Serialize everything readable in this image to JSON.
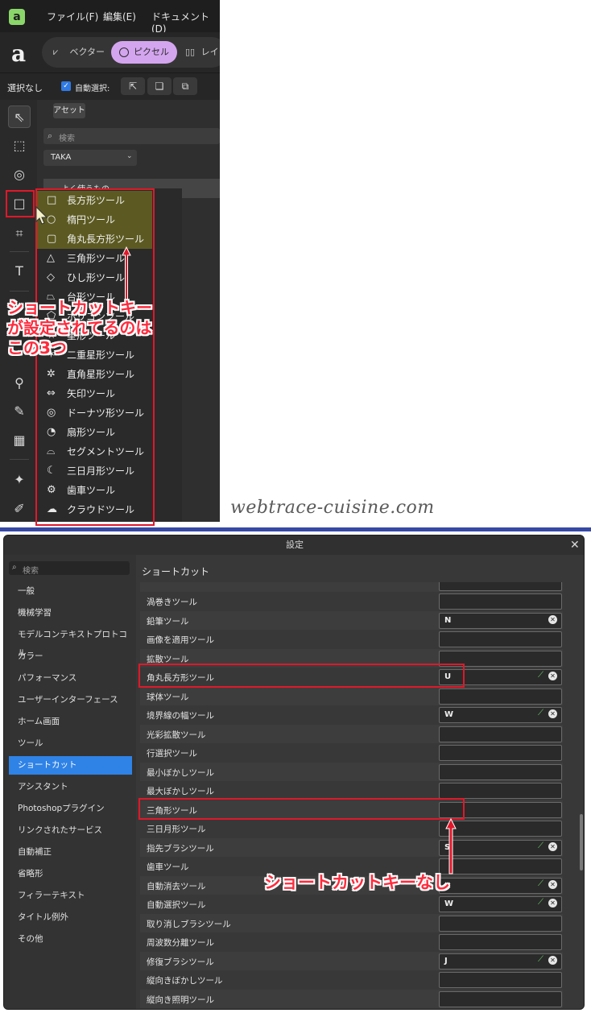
{
  "app": {
    "menus": [
      "ファイル(F)",
      "編集(E)",
      "ドキュメント(D)"
    ],
    "personas": [
      "ベクター",
      "ピクセル",
      "レイ"
    ],
    "context": {
      "selection_label": "選択なし",
      "auto_select_label": "自動選択:"
    },
    "panel": {
      "tab_label": "アセット",
      "search_placeholder": "検索",
      "library_value": "TAKA",
      "category_label": "よく使うもの"
    }
  },
  "flyout": {
    "items": [
      "長方形ツール",
      "楕円ツール",
      "角丸長方形ツール",
      "三角形ツール",
      "ひし形ツール",
      "台形ツール",
      "ポリゴンツール",
      "星形ツール",
      "二重星形ツール",
      "直角星形ツール",
      "矢印ツール",
      "ドーナツ形ツール",
      "扇形ツール",
      "セグメントツール",
      "三日月形ツール",
      "歯車ツール",
      "クラウドツール"
    ]
  },
  "annotations": {
    "callout_top": [
      "ショートカットキー",
      "が設定されてるのは",
      "この3つ"
    ],
    "callout_bottom": "ショートカットキーなし",
    "watermark": "webtrace-cuisine.com"
  },
  "dialog": {
    "title": "設定",
    "search_placeholder": "検索",
    "section_title": "ショートカット",
    "sidebar": [
      "一般",
      "機械学習",
      "モデルコンテキストプロトコル",
      "カラー",
      "パフォーマンス",
      "ユーザーインターフェース",
      "ホーム画面",
      "ツール",
      "ショートカット",
      "アシスタント",
      "Photoshopプラグイン",
      "リンクされたサービス",
      "自動補正",
      "省略形",
      "フィラーテキスト",
      "タイトル例外",
      "その他"
    ],
    "active_sidebar_index": 8,
    "rows": [
      {
        "label": "渦巻きツール",
        "key": "",
        "custom": false,
        "clear": false
      },
      {
        "label": "鉛筆ツール",
        "key": "N",
        "custom": false,
        "clear": true
      },
      {
        "label": "画像を適用ツール",
        "key": "",
        "custom": false,
        "clear": false
      },
      {
        "label": "拡散ツール",
        "key": "",
        "custom": false,
        "clear": false
      },
      {
        "label": "角丸長方形ツール",
        "key": "U",
        "custom": true,
        "clear": true
      },
      {
        "label": "球体ツール",
        "key": "",
        "custom": false,
        "clear": false
      },
      {
        "label": "境界線の幅ツール",
        "key": "W",
        "custom": true,
        "clear": true
      },
      {
        "label": "光彩拡散ツール",
        "key": "",
        "custom": false,
        "clear": false
      },
      {
        "label": "行選択ツール",
        "key": "",
        "custom": false,
        "clear": false
      },
      {
        "label": "最小ぼかしツール",
        "key": "",
        "custom": false,
        "clear": false
      },
      {
        "label": "最大ぼかしツール",
        "key": "",
        "custom": false,
        "clear": false
      },
      {
        "label": "三角形ツール",
        "key": "",
        "custom": false,
        "clear": false
      },
      {
        "label": "三日月形ツール",
        "key": "",
        "custom": false,
        "clear": false
      },
      {
        "label": "指先ブラシツール",
        "key": "S",
        "custom": true,
        "clear": true
      },
      {
        "label": "歯車ツール",
        "key": "",
        "custom": false,
        "clear": false
      },
      {
        "label": "自動消去ツール",
        "key": "",
        "custom": true,
        "clear": true
      },
      {
        "label": "自動選択ツール",
        "key": "W",
        "custom": true,
        "clear": true
      },
      {
        "label": "取り消しブラシツール",
        "key": "",
        "custom": false,
        "clear": false
      },
      {
        "label": "周波数分離ツール",
        "key": "",
        "custom": false,
        "clear": false
      },
      {
        "label": "修復ブラシツール",
        "key": "J",
        "custom": true,
        "clear": true
      },
      {
        "label": "縦向きぼかしツール",
        "key": "",
        "custom": false,
        "clear": false
      },
      {
        "label": "縦向き照明ツール",
        "key": "",
        "custom": false,
        "clear": false
      }
    ]
  },
  "colors": {
    "annotation_red": "#e0182a",
    "active_blue": "#2f82e6",
    "persona_pixel": "#d4a5ef",
    "highlight_olive": "#5c5a22"
  }
}
